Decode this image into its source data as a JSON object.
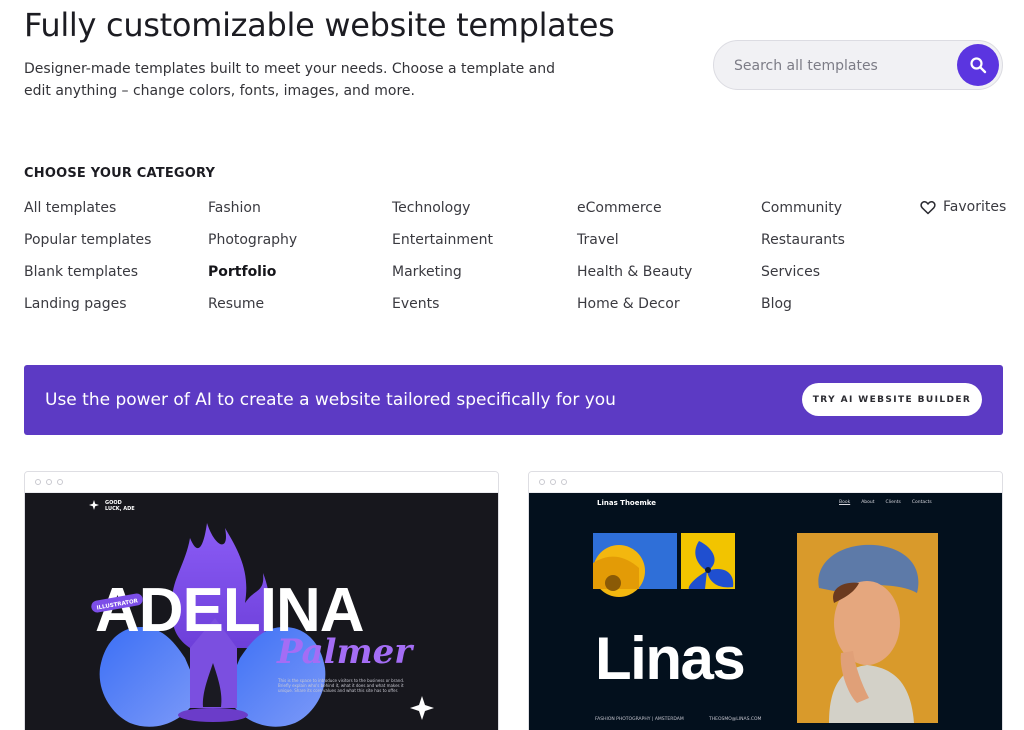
{
  "header": {
    "title": "Fully customizable website templates",
    "subtitle": "Designer-made templates built to meet your needs. Choose a template and edit anything – change colors, fonts, images, and more."
  },
  "search": {
    "placeholder": "Search all templates",
    "icon": "search-icon"
  },
  "categories": {
    "heading": "CHOOSE YOUR CATEGORY",
    "columns": [
      [
        "All templates",
        "Popular templates",
        "Blank templates",
        "Landing pages"
      ],
      [
        "Fashion",
        "Photography",
        "Portfolio",
        "Resume"
      ],
      [
        "Technology",
        "Entertainment",
        "Marketing",
        "Events"
      ],
      [
        "eCommerce",
        "Travel",
        "Health & Beauty",
        "Home & Decor"
      ],
      [
        "Community",
        "Restaurants",
        "Services",
        "Blog"
      ]
    ],
    "active": "Portfolio",
    "favorites": "Favorites"
  },
  "ai_banner": {
    "text": "Use the power of AI to create a website tailored specifically for you",
    "button": "TRY AI WEBSITE BUILDER",
    "color": "#5c3ac4"
  },
  "templates": [
    {
      "logo_line1": "GOOD",
      "logo_line2": "LUCK, ADE",
      "name_main": "ADELINA",
      "name_script": "Palmer",
      "tag": "ILLUSTRATOR",
      "blurb": "This is the space to introduce visitors to the business or brand. Briefly explain who's behind it, what it does and what makes it unique. Share its core values and what this site has to offer."
    },
    {
      "site_name": "Linas Thoemke",
      "nav": [
        "Book",
        "About",
        "Clients",
        "Contacts"
      ],
      "big_name": "Linas",
      "footer_left": "FASHION PHOTOGRAPHY | AMSTERDAM",
      "footer_right": "THEOSMO@LINAS.COM"
    }
  ],
  "colors": {
    "accent": "#5b35e0",
    "banner": "#5c3ac4"
  }
}
